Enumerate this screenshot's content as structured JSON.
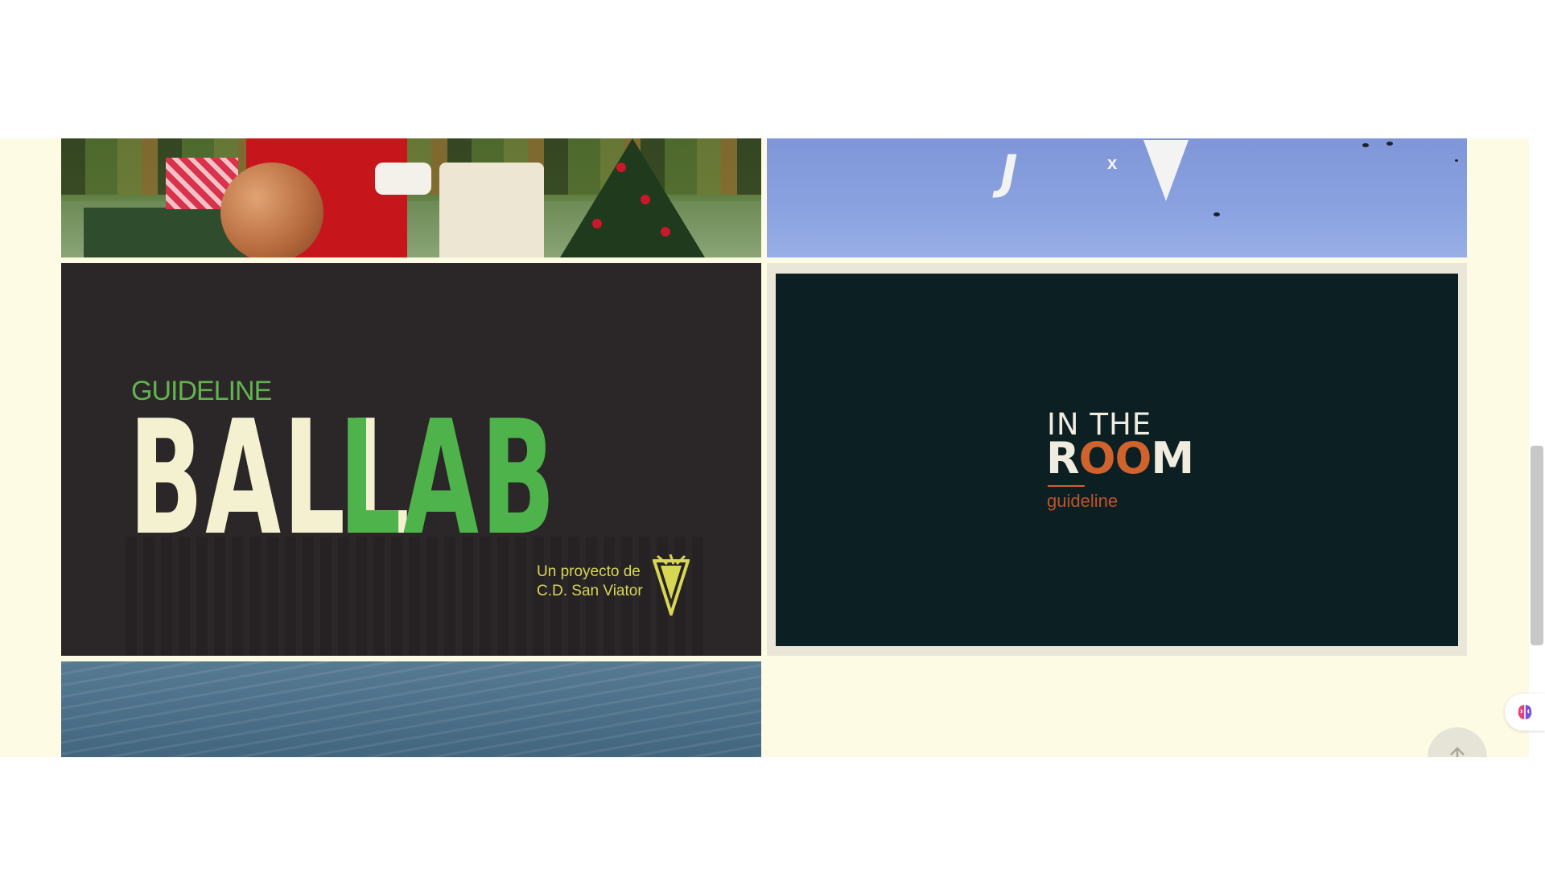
{
  "tiles": {
    "ballab": {
      "guideline": "GUIDELINE",
      "ball": "BALL",
      "lab": "LAB",
      "project_line1": "Un proyecto de",
      "project_line2": "C.D. San Viator"
    },
    "room": {
      "in_the": "IN THE",
      "room_r": "R",
      "room_oo": "OO",
      "room_m": "M",
      "subtitle": "guideline"
    },
    "sky": {
      "brand": "J",
      "separator": "x"
    }
  },
  "colors": {
    "page_background": "#fdfbe4",
    "ballab_bg": "#2b2728",
    "ballab_green": "#4db34a",
    "ballab_cream": "#f3f1cf",
    "room_bg": "#0c1f22",
    "room_orange": "#d0622d"
  },
  "icons": {
    "brain_widget": "brain-icon",
    "back_to_top": "arrow-up-icon"
  }
}
